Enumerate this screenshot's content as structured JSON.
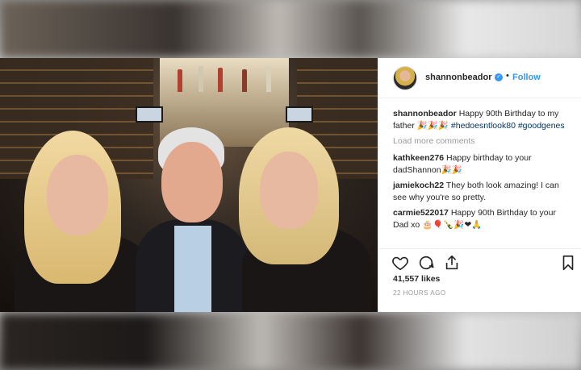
{
  "post": {
    "username": "shannonbeador",
    "verified_icon": "verified-badge-icon",
    "separator": "•",
    "follow_label": "Follow",
    "caption": {
      "username": "shannonbeador",
      "text": "Happy 90th Birthday to my father 🎉🎉🎉",
      "hashtags": [
        "#hedoesntlook80",
        "#goodgenes"
      ]
    },
    "load_more": "Load more comments",
    "comments": [
      {
        "username": "kathkeen276",
        "text": "Happy birthday to your dadShannon🎉🎉"
      },
      {
        "username": "jamiekoch22",
        "text": "They both look amazing! I can see why you're so pretty."
      },
      {
        "username": "carmie522017",
        "text": "Happy 90th Birthday to your Dad xo 🎂🎈🍾🎉❤🙏"
      }
    ],
    "likes": "41,557 likes",
    "time_ago": "22 HOURS AGO"
  },
  "icons": {
    "like": "heart-icon",
    "comment": "comment-icon",
    "share": "share-icon",
    "save": "bookmark-icon"
  },
  "colors": {
    "link_blue": "#3897f0",
    "hashtag": "#003569",
    "muted": "#999999",
    "text": "#262626"
  }
}
